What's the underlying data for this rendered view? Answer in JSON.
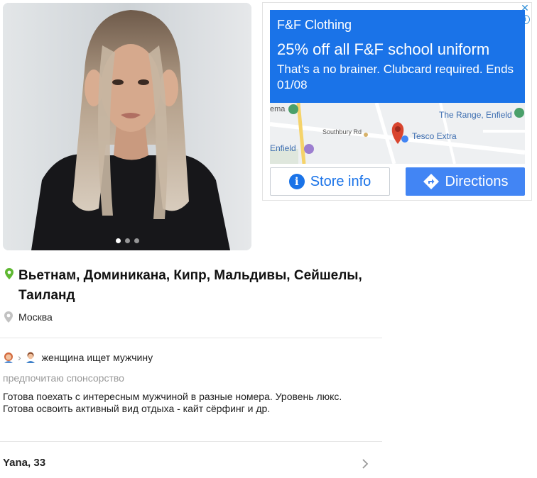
{
  "photo": {
    "slide_count": 3,
    "active_slide": 1
  },
  "ad": {
    "brand": "F&F Clothing",
    "headline": "25% off all F&F school uniform",
    "description": "That's a no brainer. Clubcard required. Ends 01/08",
    "map_labels": {
      "cinema": "ema",
      "range": "The Range, Enfield",
      "road": "Southbury Rd",
      "tesco": "Tesco Extra",
      "enfield": "Enfield"
    },
    "store_info_label": "Store info",
    "directions_label": "Directions",
    "colors": {
      "banner": "#1a73e8",
      "button": "#4285f4"
    }
  },
  "profile": {
    "destinations": "Вьетнам, Доминикана, Кипр, Мальдивы, Сейшелы, Таиланд",
    "city": "Москва",
    "seeking": "женщина ищет мужчину",
    "preference": "предпочитаю спонсорство",
    "about_line1": "Готова поехать с интересным мужчиной в разные номера. Уровень люкс.",
    "about_line2": "Готова освоить активный вид отдыха - кайт сёрфинг и др.",
    "name_age": "Yana, 33"
  }
}
